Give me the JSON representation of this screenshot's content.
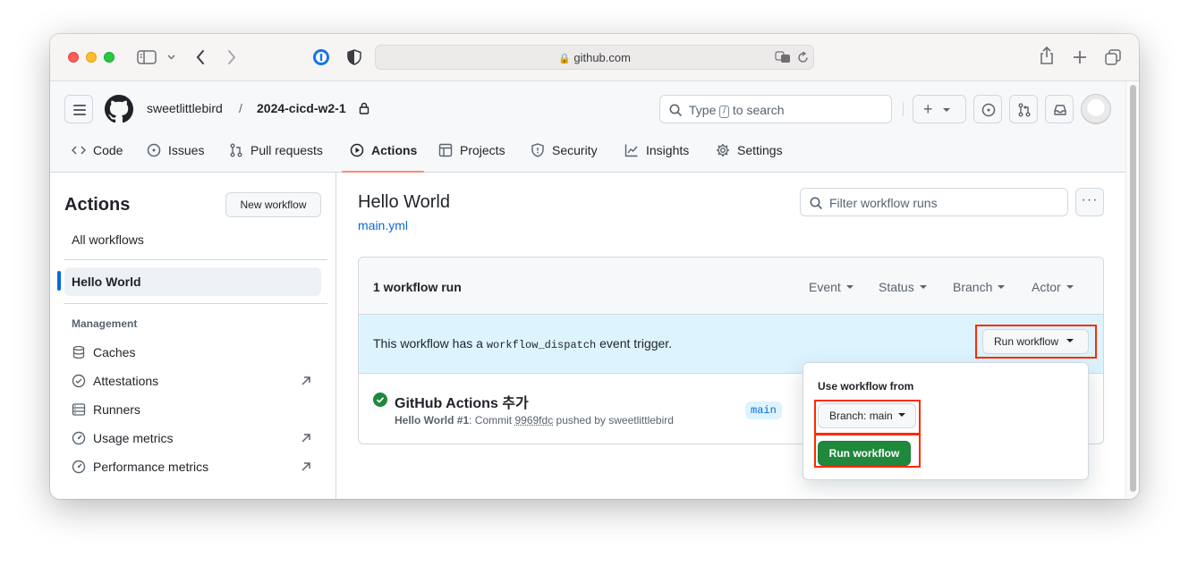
{
  "browser": {
    "url": "github.com"
  },
  "header": {
    "owner": "sweetlittlebird",
    "separator": "/",
    "repo": "2024-cicd-w2-1",
    "search_prefix": "Type",
    "search_key": "/",
    "search_suffix": "to search",
    "plus_label": "+"
  },
  "nav": {
    "tabs": [
      {
        "label": "Code"
      },
      {
        "label": "Issues"
      },
      {
        "label": "Pull requests"
      },
      {
        "label": "Actions"
      },
      {
        "label": "Projects"
      },
      {
        "label": "Security"
      },
      {
        "label": "Insights"
      },
      {
        "label": "Settings"
      }
    ],
    "selected": "Actions"
  },
  "sidebar": {
    "title": "Actions",
    "new_workflow": "New workflow",
    "all_workflows": "All workflows",
    "active_workflow": "Hello World",
    "management_heading": "Management",
    "items": [
      {
        "label": "Caches"
      },
      {
        "label": "Attestations"
      },
      {
        "label": "Runners"
      },
      {
        "label": "Usage metrics"
      },
      {
        "label": "Performance metrics"
      }
    ]
  },
  "main": {
    "title": "Hello World",
    "file_link": "main.yml",
    "filter_placeholder": "Filter workflow runs",
    "kebab": "···",
    "run_count": "1 workflow run",
    "filters": [
      "Event",
      "Status",
      "Branch",
      "Actor"
    ],
    "dispatch_pre": "This workflow has a",
    "dispatch_code": "workflow_dispatch",
    "dispatch_post": "event trigger.",
    "run_workflow_btn": "Run workflow",
    "run": {
      "title": "GitHub Actions 추가",
      "workflow": "Hello World #1",
      "commit_label": ": Commit",
      "commit_hash": "9969fdc",
      "pushed_by": "pushed by sweetlittlebird",
      "branch": "main"
    }
  },
  "popover": {
    "label": "Use workflow from",
    "branch_btn": "Branch: main",
    "run_btn": "Run workflow"
  },
  "colors": {
    "accent": "#0969da",
    "success": "#1f883d",
    "highlight_red": "#ff2a00",
    "tab_underline": "#fd8c73",
    "info_bg": "#ddf4ff"
  }
}
